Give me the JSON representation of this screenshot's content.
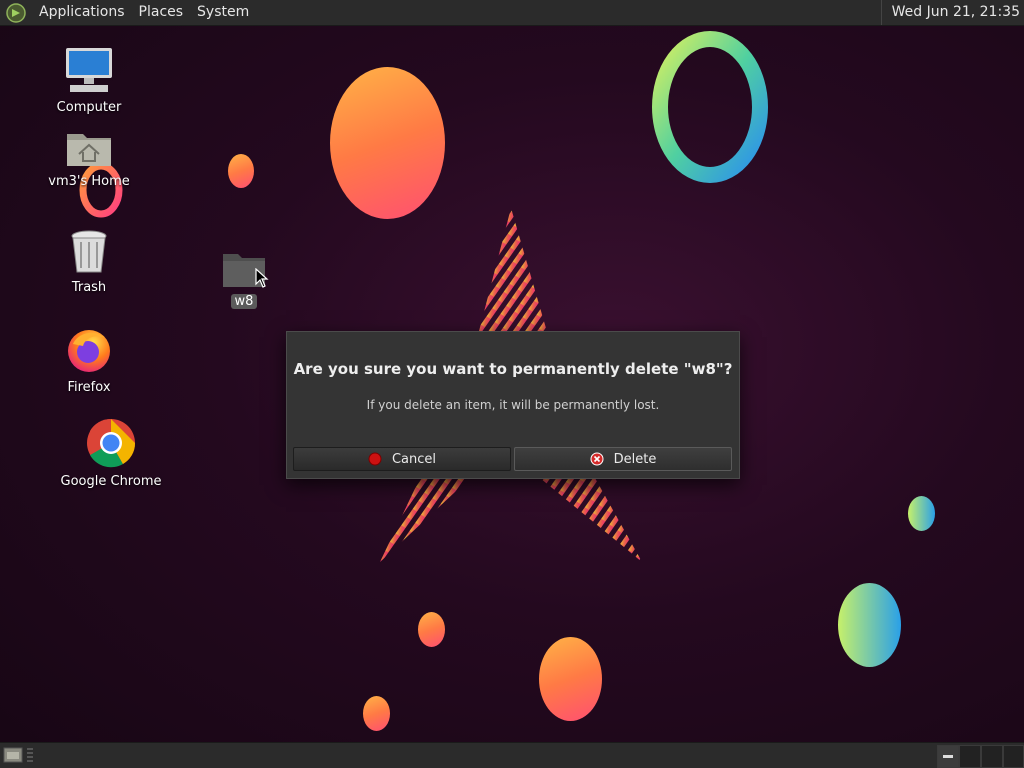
{
  "top_panel": {
    "menus": [
      "Applications",
      "Places",
      "System"
    ],
    "clock": "Wed Jun 21, 21:35"
  },
  "desktop": {
    "icons": [
      {
        "label": "Computer",
        "icon": "computer-icon"
      },
      {
        "label": "vm3's Home",
        "icon": "home-folder-icon"
      },
      {
        "label": "Trash",
        "icon": "trash-icon"
      },
      {
        "label": "Firefox",
        "icon": "firefox-icon"
      },
      {
        "label": "Google Chrome",
        "icon": "chrome-icon"
      }
    ],
    "selected_folder": {
      "label": "w8",
      "icon": "folder-icon"
    }
  },
  "dialog": {
    "title": "Are you sure you want to permanently delete \"w8\"?",
    "message": "If you delete an item, it will be permanently lost.",
    "cancel_label": "Cancel",
    "delete_label": "Delete"
  },
  "colors": {
    "panel": "#2b2b2b",
    "dialog": "#343434",
    "cancel_icon": "#cc1111",
    "delete_icon": "#d42a2a"
  }
}
